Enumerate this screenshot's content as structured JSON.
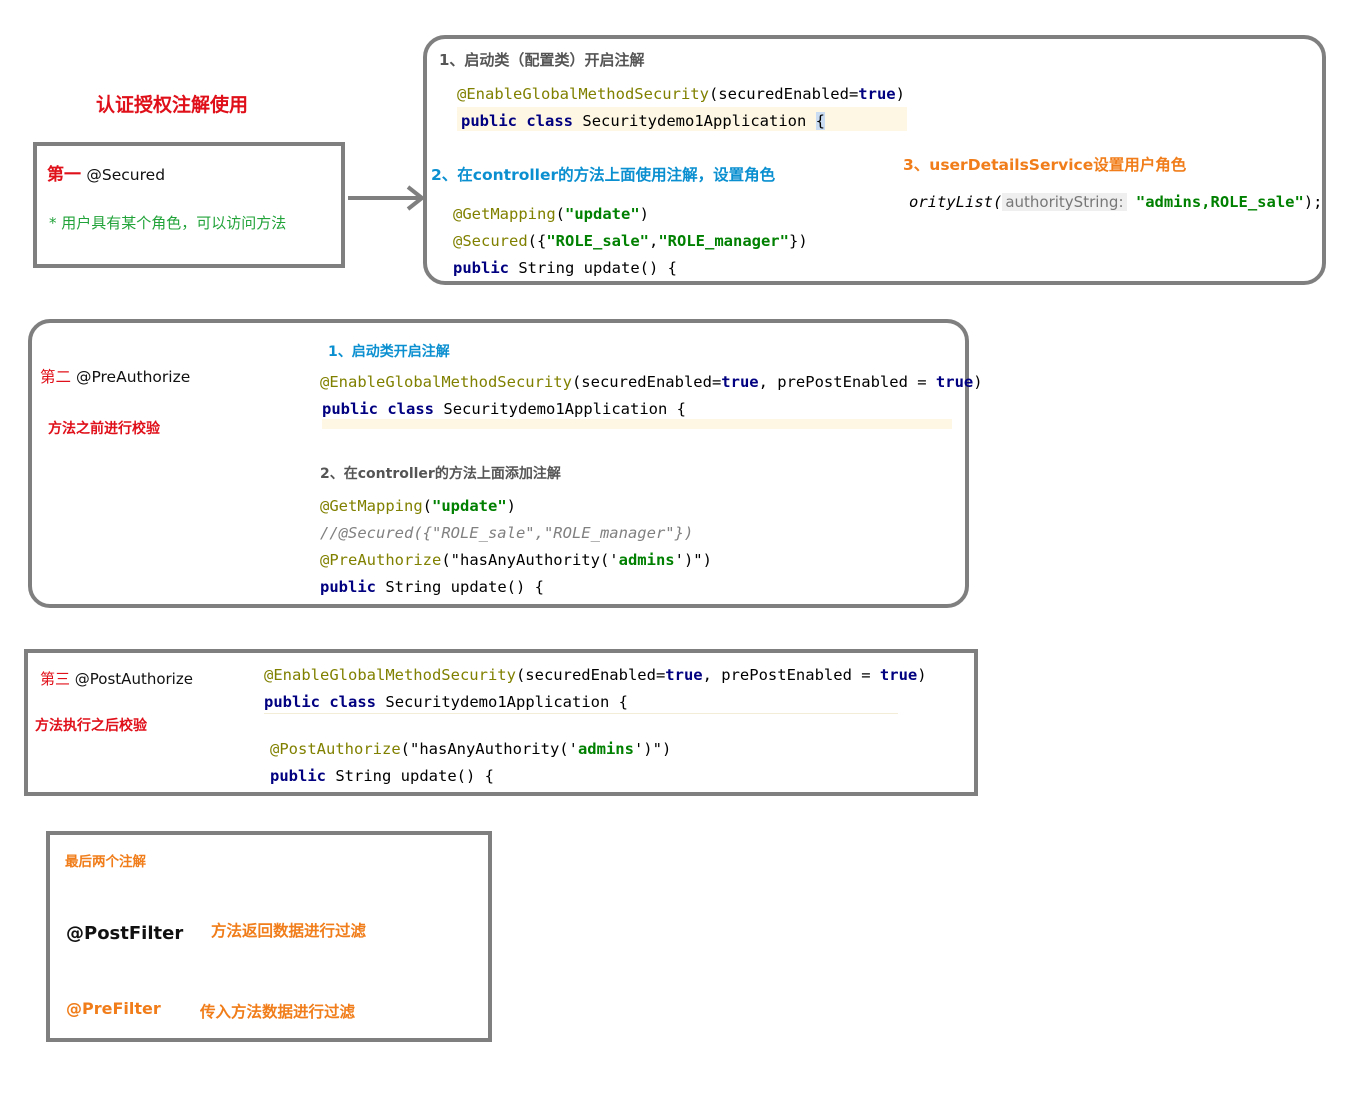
{
  "page_title": "认证授权注解使用",
  "secured": {
    "heading_prefix": "第一",
    "heading_name": "@Secured",
    "desc": "* 用户具有某个角色，可以访问方法",
    "step1": "1、启动类（配置类）开启注解",
    "code1": {
      "l1_ann": "@EnableGlobalMethodSecurity",
      "l1_rest": "(securedEnabled=",
      "l1_true": "true",
      "l1_end": ")",
      "l2_kw1": "public",
      "l2_kw2": "class",
      "l2_name": "Securitydemo1Application",
      "l2_brace": "{"
    },
    "step2": "2、在controller的方法上面使用注解，设置角色",
    "code2": {
      "l1_ann": "@GetMapping",
      "l1_open": "(",
      "l1_str": "\"update\"",
      "l1_close": ")",
      "l2_ann": "@Secured",
      "l2_open": "({",
      "l2_str1": "\"ROLE_sale\"",
      "l2_comma": ",",
      "l2_str2": "\"ROLE_manager\"",
      "l2_close": "})",
      "l3_kw": "public",
      "l3_rest": "String update()  {"
    },
    "step3": "3、userDetailsService设置用户角色",
    "code3": {
      "method": "orityList(",
      "hint": "authorityString:",
      "str": "\"admins,ROLE_sale\"",
      "end": ");"
    }
  },
  "preauthorize": {
    "heading_prefix": "第二",
    "heading_name": "@PreAuthorize",
    "desc": "方法之前进行校验",
    "step1": "1、启动类开启注解",
    "code1": {
      "l1_ann": "@EnableGlobalMethodSecurity",
      "l1_rest1": "(securedEnabled=",
      "l1_true1": "true",
      "l1_rest2": ", prePostEnabled = ",
      "l1_true2": "true",
      "l1_end": ")",
      "l2_kw1": "public",
      "l2_kw2": "class",
      "l2_name": "Securitydemo1Application",
      "l2_brace": "{"
    },
    "step2": "2、在controller的方法上面添加注解",
    "code2": {
      "l1_ann": "@GetMapping",
      "l1_open": "(",
      "l1_str": "\"update\"",
      "l1_close": ")",
      "l2_comment": "//@Secured({\"ROLE_sale\",\"ROLE_manager\"})",
      "l3_ann": "@PreAuthorize",
      "l3_open": "(\"hasAnyAuthority('",
      "l3_str": "admins",
      "l3_close": "')\")",
      "l4_kw": "public",
      "l4_rest": "String update()  {"
    }
  },
  "postauthorize": {
    "heading_prefix": "第三",
    "heading_name": "@PostAuthorize",
    "desc": "方法执行之后校验",
    "code1": {
      "l1_ann": "@EnableGlobalMethodSecurity",
      "l1_rest1": "(securedEnabled=",
      "l1_true1": "true",
      "l1_rest2": ", prePostEnabled = ",
      "l1_true2": "true",
      "l1_end": ")",
      "l2_kw1": "public",
      "l2_kw2": "class",
      "l2_name": "Securitydemo1Application",
      "l2_brace": "{"
    },
    "code2": {
      "l1_ann": "@PostAuthorize",
      "l1_open": "(\"hasAnyAuthority('",
      "l1_str": "admins",
      "l1_close": "')\")",
      "l2_kw": "public",
      "l2_rest": "String update()  {"
    }
  },
  "filters": {
    "title": "最后两个注解",
    "post_name": "@PostFilter",
    "post_desc": "方法返回数据进行过滤",
    "pre_name": "@PreFilter",
    "pre_desc": "传入方法数据进行过滤"
  },
  "colors": {
    "border": "#7f7f7f",
    "red": "#e0101a",
    "green": "#22a33a",
    "blue": "#0a8fd0",
    "orange": "#f07d1a",
    "annotation": "#808000",
    "keyword": "#000080",
    "string": "#008000"
  }
}
